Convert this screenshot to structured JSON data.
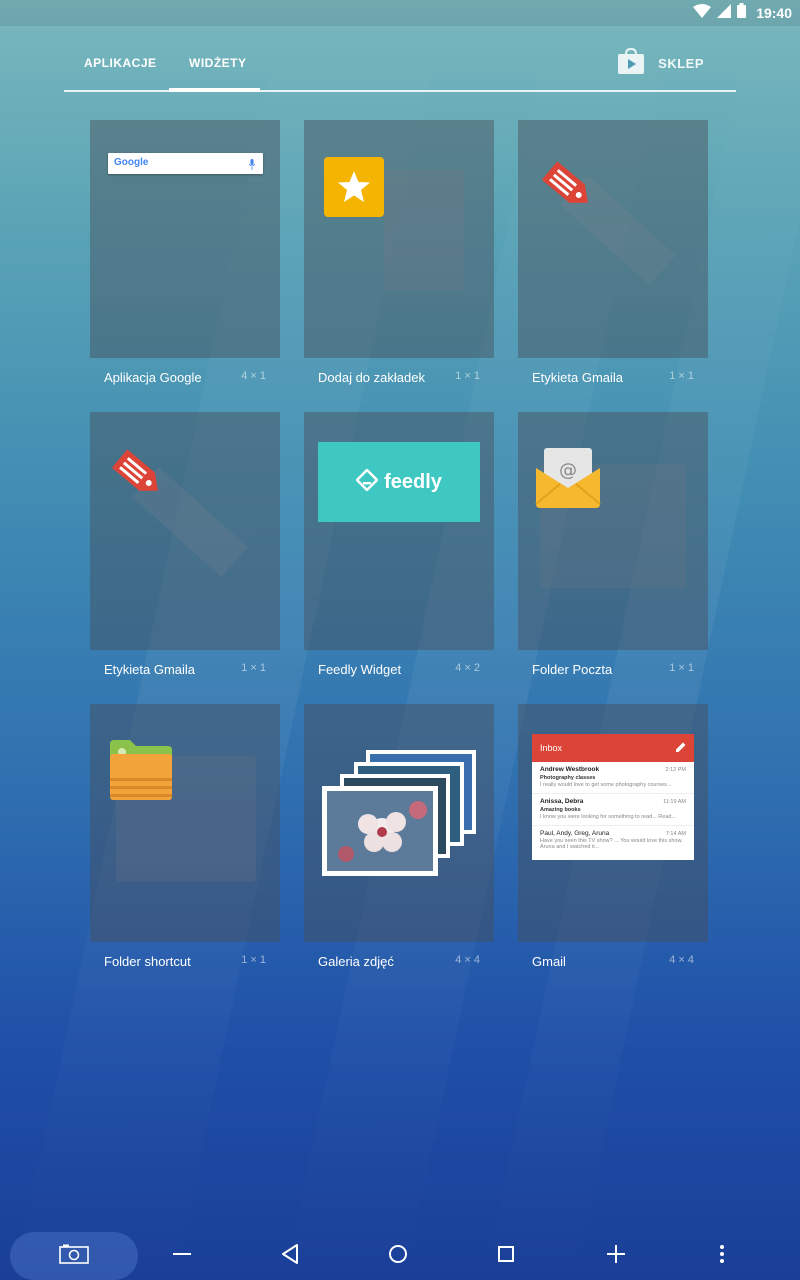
{
  "status_bar": {
    "time": "19:40",
    "icons": [
      "wifi-icon",
      "signal-icon",
      "battery-icon"
    ]
  },
  "tabs": {
    "apps_label": "APLIKACJE",
    "widgets_label": "WIDŻETY",
    "active": "widgets"
  },
  "store": {
    "label": "SKLEP",
    "icon": "play-store-bag-icon"
  },
  "widgets": [
    {
      "label": "Aplikacja Google",
      "size": "4 × 1",
      "icon": "google-search-bar"
    },
    {
      "label": "Dodaj do zakładek",
      "size": "1 × 1",
      "icon": "bookmark-star-icon"
    },
    {
      "label": "Etykieta Gmaila",
      "size": "1 × 1",
      "icon": "gmail-label-tag-icon"
    },
    {
      "label": "Etykieta Gmaila",
      "size": "1 × 1",
      "icon": "gmail-label-tag-icon"
    },
    {
      "label": "Feedly Widget",
      "size": "4 × 2",
      "icon": "feedly-logo",
      "preview_text": "feedly"
    },
    {
      "label": "Folder Poczta",
      "size": "1 × 1",
      "icon": "mail-folder-icon"
    },
    {
      "label": "Folder shortcut",
      "size": "1 × 1",
      "icon": "folder-icon"
    },
    {
      "label": "Galeria zdjęć",
      "size": "4 × 4",
      "icon": "photo-stack-icon"
    },
    {
      "label": "Gmail",
      "size": "4 × 4",
      "icon": "gmail-inbox-preview"
    }
  ],
  "google_preview": {
    "logo": "Google"
  },
  "gmail_preview": {
    "header": "Inbox",
    "items": [
      {
        "from": "Andrew Westbrook",
        "subject": "Photography classes",
        "preview": "I really would love to get some photography courses...",
        "time": "2:12 PM"
      },
      {
        "from": "Anissa, Debra",
        "subject": "Amazing books",
        "preview": "I know you were looking for something to read... Read...",
        "time": "11:19 AM"
      },
      {
        "from": "Paul, Andy, Greg, Aruna",
        "subject": "",
        "preview": "Have you seen this TV show? ... You would love this show. Aruna and I watched it...",
        "time": "7:14 AM"
      }
    ]
  },
  "nav_bar": {
    "buttons": [
      "screenshot",
      "minus",
      "back",
      "home",
      "recents",
      "plus",
      "more"
    ]
  },
  "colors": {
    "accent": "#ffffff",
    "gmail_red": "#db4437",
    "feedly_teal": "#3fc7c1",
    "bookmark_yellow": "#f4b400"
  }
}
